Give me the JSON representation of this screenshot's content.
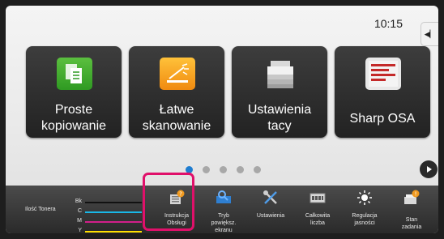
{
  "status": {
    "time": "10:15"
  },
  "home": {
    "tiles": [
      {
        "label": "Proste kopiowanie",
        "line1": "Proste",
        "line2": "kopiowanie",
        "icon": "copy-icon"
      },
      {
        "label": "Łatwe skanowanie",
        "line1": "Łatwe",
        "line2": "skanowanie",
        "icon": "scan-icon"
      },
      {
        "label": "Ustawienia tacy",
        "line1": "Ustawienia",
        "line2": "tacy",
        "icon": "printer-tray-icon"
      },
      {
        "label": "Sharp OSA",
        "line1": "Sharp OSA",
        "line2": "",
        "icon": "osa-icon"
      }
    ],
    "pages": {
      "count": 5,
      "current": 1
    }
  },
  "taskbar": {
    "toner": {
      "label": "Ilość Tonera",
      "channels": [
        {
          "name": "Bk",
          "color": "#111111"
        },
        {
          "name": "C",
          "color": "#19b7e6"
        },
        {
          "name": "M",
          "color": "#d21f8a"
        },
        {
          "name": "Y",
          "color": "#ffe000"
        }
      ]
    },
    "items": [
      {
        "line1": "Instrukcja",
        "line2": "Obsługi",
        "line3": "",
        "icon": "manual-icon"
      },
      {
        "line1": "Tryb",
        "line2": "powiększ.",
        "line3": "ekranu",
        "icon": "zoom-mode-icon"
      },
      {
        "line1": "Ustawienia",
        "line2": "",
        "line3": "",
        "icon": "tools-icon"
      },
      {
        "line1": "Całkowita",
        "line2": "liczba",
        "line3": "",
        "icon": "counter-icon"
      },
      {
        "line1": "Regulacja",
        "line2": "jasności",
        "line3": "",
        "icon": "brightness-icon"
      },
      {
        "line1": "Stan",
        "line2": "zadania",
        "line3": "",
        "icon": "job-status-icon"
      }
    ]
  },
  "colors": {
    "highlight": "#e0106a",
    "page_dot_active": "#1f7dd0",
    "tile_bg": "#2e2e2e"
  }
}
